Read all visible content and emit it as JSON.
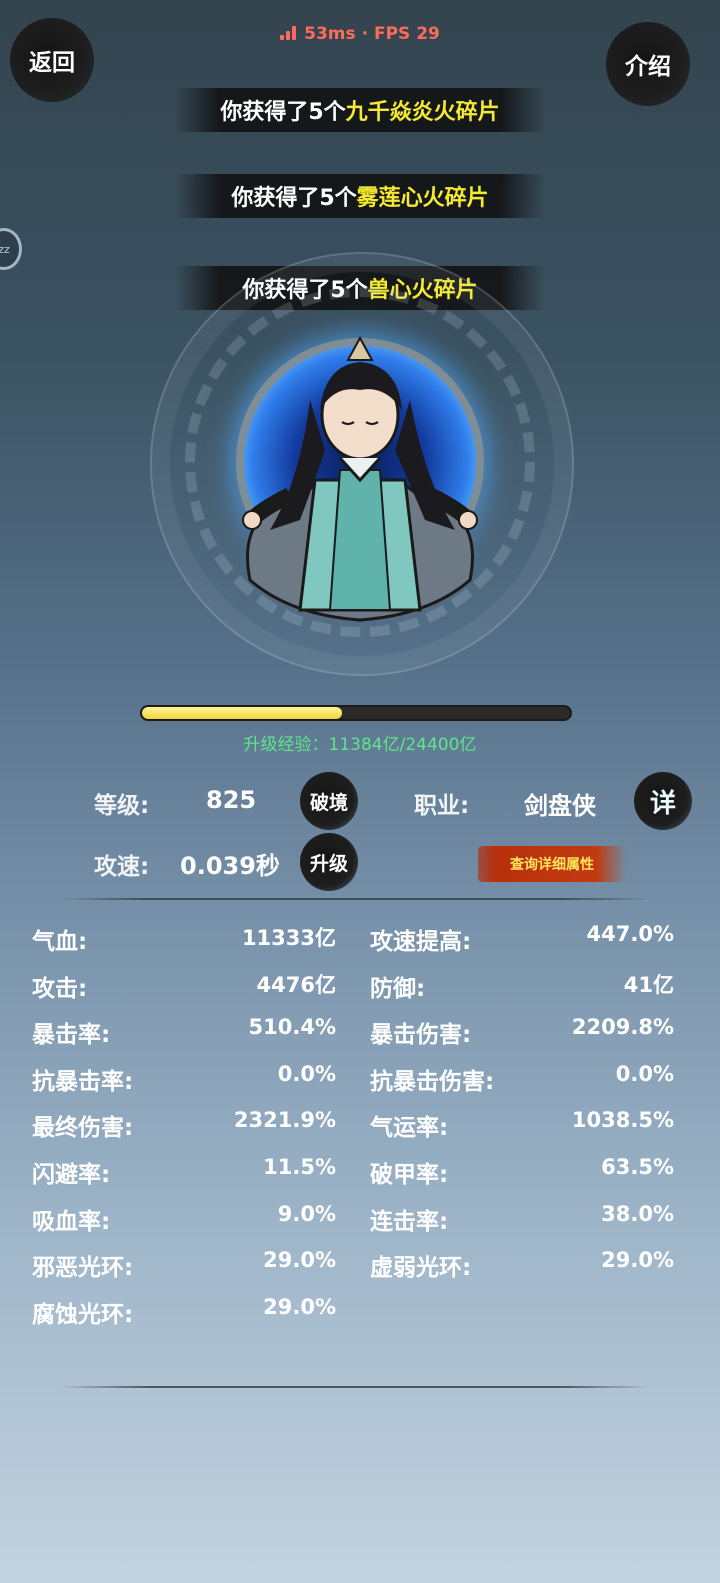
{
  "status": {
    "ping": "53ms",
    "separator": "·",
    "fps": "FPS 29"
  },
  "nav": {
    "back_label": "返回",
    "intro_label": "介绍",
    "side_bubble": "zz"
  },
  "notices": [
    {
      "prefix": "你获得了5个",
      "item": "九千焱炎火碎片"
    },
    {
      "prefix": "你获得了5个",
      "item": "雾莲心火碎片"
    },
    {
      "prefix": "你获得了5个",
      "item": "兽心火碎片"
    }
  ],
  "exp": {
    "text": "升级经验：11384亿/24400亿",
    "progress": 0.4666
  },
  "info": {
    "level_label": "等级:",
    "level_value": "825",
    "breakthrough_label": "破境",
    "class_label": "职业:",
    "class_value": "剑盘侠",
    "detail_label": "详",
    "speed_label": "攻速:",
    "speed_value": "0.039秒",
    "upgrade_label": "升级",
    "query_label": "查询详细属性"
  },
  "stats": [
    {
      "left_label": "气血:",
      "left_value": "11333亿",
      "right_label": "攻速提高:",
      "right_value": "447.0%"
    },
    {
      "left_label": "攻击:",
      "left_value": "4476亿",
      "right_label": "防御:",
      "right_value": "41亿"
    },
    {
      "left_label": "暴击率:",
      "left_value": "510.4%",
      "right_label": "暴击伤害:",
      "right_value": "2209.8%"
    },
    {
      "left_label": "抗暴击率:",
      "left_value": "0.0%",
      "right_label": "抗暴击伤害:",
      "right_value": "0.0%"
    },
    {
      "left_label": "最终伤害:",
      "left_value": "2321.9%",
      "right_label": "气运率:",
      "right_value": "1038.5%"
    },
    {
      "left_label": "闪避率:",
      "left_value": "11.5%",
      "right_label": "破甲率:",
      "right_value": "63.5%"
    },
    {
      "left_label": "吸血率:",
      "left_value": "9.0%",
      "right_label": "连击率:",
      "right_value": "38.0%"
    },
    {
      "left_label": "邪恶光环:",
      "left_value": "29.0%",
      "right_label": "虚弱光环:",
      "right_value": "29.0%"
    },
    {
      "left_label": "腐蚀光环:",
      "left_value": "29.0%",
      "right_label": "",
      "right_value": ""
    }
  ],
  "colors": {
    "highlight": "#f5ea2f",
    "exp_text": "#5fe58a",
    "status": "#ff6b5a",
    "query_btn": "#c23a10"
  }
}
